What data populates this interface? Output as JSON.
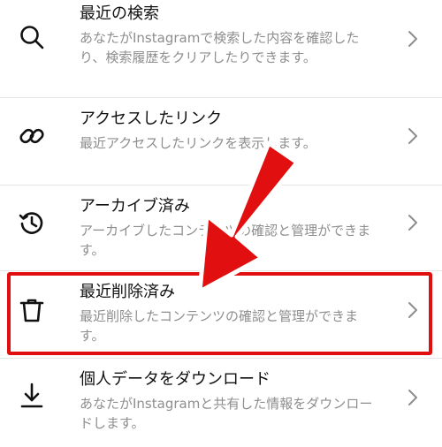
{
  "items": [
    {
      "title": "最近の検索",
      "description": "あなたがInstagramで検索した内容を確認したり、検索履歴をクリアしたりできます。",
      "icon": "search-icon"
    },
    {
      "title": "アクセスしたリンク",
      "description": "最近アクセスしたリンクを表示します。",
      "icon": "link-icon"
    },
    {
      "title": "アーカイブ済み",
      "description": "アーカイブしたコンテンツの確認と管理ができます。",
      "icon": "history-icon"
    },
    {
      "title": "最近削除済み",
      "description": "最近削除したコンテンツの確認と管理ができます。",
      "icon": "trash-icon"
    },
    {
      "title": "個人データをダウンロード",
      "description": "あなたがInstagramと共有した情報をダウンロードします。",
      "icon": "download-icon"
    }
  ],
  "colors": {
    "highlight": "#e10f0f",
    "arrow": "#e10f0f",
    "title": "#111111",
    "description": "#8e8e8e"
  }
}
